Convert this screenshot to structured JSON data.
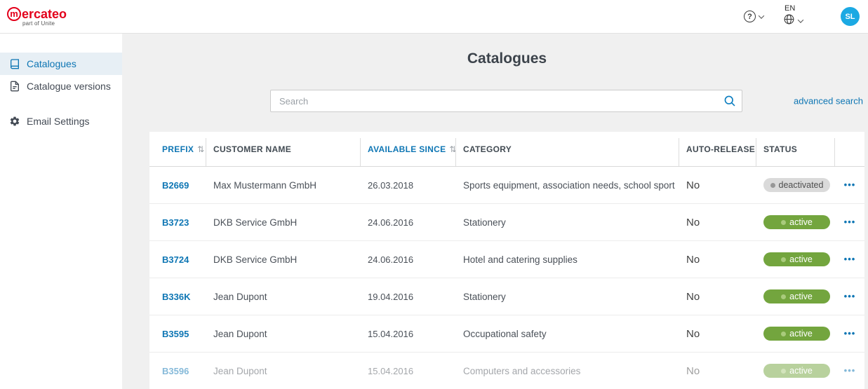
{
  "brand": {
    "initial": "m",
    "rest": "ercateo",
    "tagline": "part of Unite"
  },
  "header": {
    "language": "EN",
    "avatar_initials": "SL"
  },
  "icons": {
    "help": "?",
    "sort": "⇅",
    "ellipsis": "•••"
  },
  "sidebar": {
    "items": [
      {
        "label": "Catalogues"
      },
      {
        "label": "Catalogue versions"
      },
      {
        "label": "Email Settings"
      }
    ]
  },
  "main": {
    "title": "Catalogues",
    "search_placeholder": "Search",
    "advanced_search": "advanced search"
  },
  "table": {
    "columns": [
      {
        "label": "PREFIX"
      },
      {
        "label": "CUSTOMER NAME"
      },
      {
        "label": "AVAILABLE SINCE"
      },
      {
        "label": "CATEGORY"
      },
      {
        "label": "AUTO-RELEASE"
      },
      {
        "label": "STATUS"
      }
    ],
    "rows": [
      {
        "prefix": "B2669",
        "customer": "Max Mustermann GmbH",
        "available_since": "26.03.2018",
        "category": "Sports equipment, association needs, school sport",
        "auto_release": "No",
        "status": "deactivated"
      },
      {
        "prefix": "B3723",
        "customer": "DKB Service GmbH",
        "available_since": "24.06.2016",
        "category": "Stationery",
        "auto_release": "No",
        "status": "active"
      },
      {
        "prefix": "B3724",
        "customer": "DKB Service GmbH",
        "available_since": "24.06.2016",
        "category": "Hotel and catering supplies",
        "auto_release": "No",
        "status": "active"
      },
      {
        "prefix": "B336K",
        "customer": "Jean Dupont",
        "available_since": "19.04.2016",
        "category": "Stationery",
        "auto_release": "No",
        "status": "active"
      },
      {
        "prefix": "B3595",
        "customer": "Jean Dupont",
        "available_since": "15.04.2016",
        "category": "Occupational safety",
        "auto_release": "No",
        "status": "active"
      },
      {
        "prefix": "B3596",
        "customer": "Jean Dupont",
        "available_since": "15.04.2016",
        "category": "Computers and accessories",
        "auto_release": "No",
        "status": "active"
      }
    ]
  },
  "colors": {
    "accent_blue": "#0e76b4",
    "brand_red": "#e3001b",
    "active_green": "#73a53e",
    "deactivated_gray": "#dadada",
    "avatar_blue": "#1ba9e3"
  }
}
